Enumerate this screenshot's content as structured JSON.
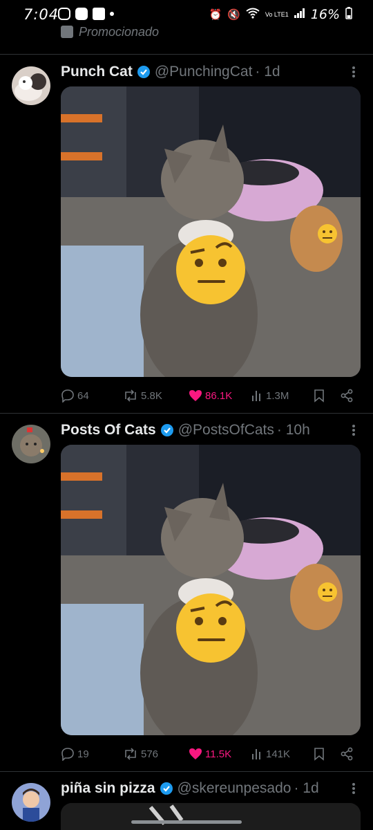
{
  "status_bar": {
    "time": "7:04",
    "battery": "16%",
    "network": "Vo LTE1"
  },
  "promoted_label": "Promocionado",
  "posts": [
    {
      "name": "Punch Cat",
      "handle": "@PunchingCat",
      "time": "· 1d",
      "replies": "64",
      "reposts": "5.8K",
      "likes": "86.1K",
      "views": "1.3M"
    },
    {
      "name": "Posts Of Cats",
      "handle": "@PostsOfCats",
      "time": "· 10h",
      "replies": "19",
      "reposts": "576",
      "likes": "11.5K",
      "views": "141K"
    },
    {
      "name": "piña sin pizza",
      "handle": "@skereunpesado",
      "time": "· 1d"
    }
  ],
  "colors": {
    "background": "#000000",
    "text_primary": "#e7e9ea",
    "text_secondary": "#71767b",
    "verified_blue": "#1d9bf0",
    "like_pink": "#f91880"
  }
}
